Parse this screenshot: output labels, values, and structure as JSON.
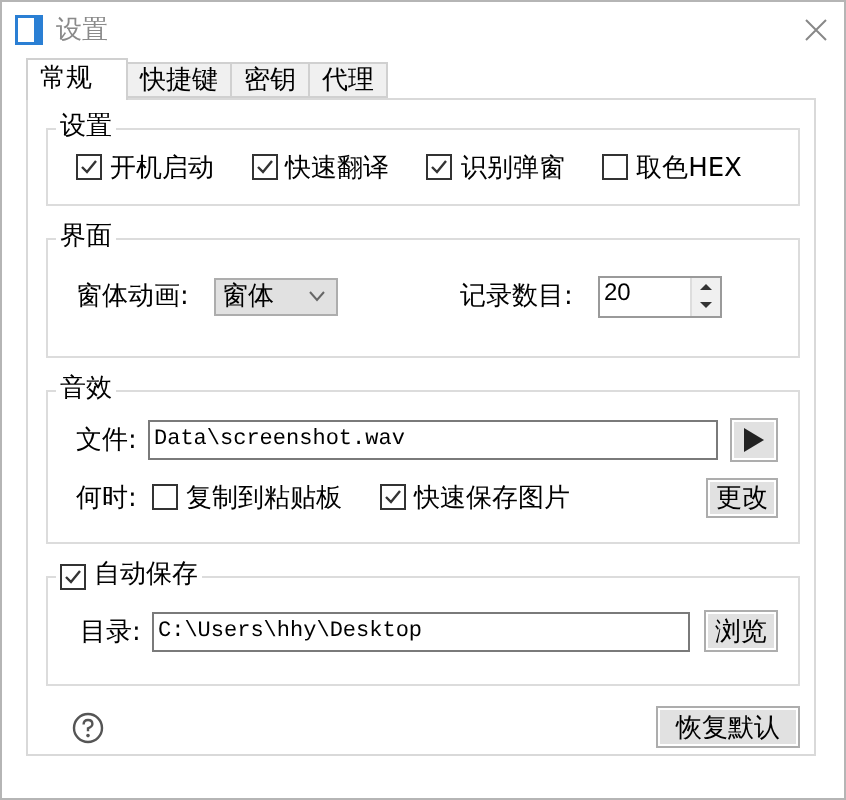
{
  "window": {
    "title": "设置"
  },
  "tabs": [
    {
      "label": "常规",
      "selected": true
    },
    {
      "label": "快捷键",
      "selected": false
    },
    {
      "label": "密钥",
      "selected": false
    },
    {
      "label": "代理",
      "selected": false
    }
  ],
  "general": {
    "title": "设置",
    "options": [
      {
        "label": "开机启动",
        "checked": true
      },
      {
        "label": "快速翻译",
        "checked": true
      },
      {
        "label": "识别弹窗",
        "checked": true
      },
      {
        "label": "取色HEX",
        "checked": false
      }
    ]
  },
  "interface": {
    "title": "界面",
    "animation_label": "窗体动画:",
    "animation_value": "窗体",
    "records_label": "记录数目:",
    "records_value": "20"
  },
  "sound": {
    "title": "音效",
    "file_label": "文件:",
    "file_value": "Data\\screenshot.wav",
    "when_label": "何时:",
    "triggers": [
      {
        "label": "复制到粘贴板",
        "checked": false
      },
      {
        "label": "快速保存图片",
        "checked": true
      }
    ],
    "change_button": "更改"
  },
  "autosave": {
    "title": "自动保存",
    "checked": true,
    "dir_label": "目录:",
    "dir_value": "C:\\Users\\hhy\\Desktop",
    "browse_button": "浏览"
  },
  "footer": {
    "restore_button": "恢复默认"
  }
}
